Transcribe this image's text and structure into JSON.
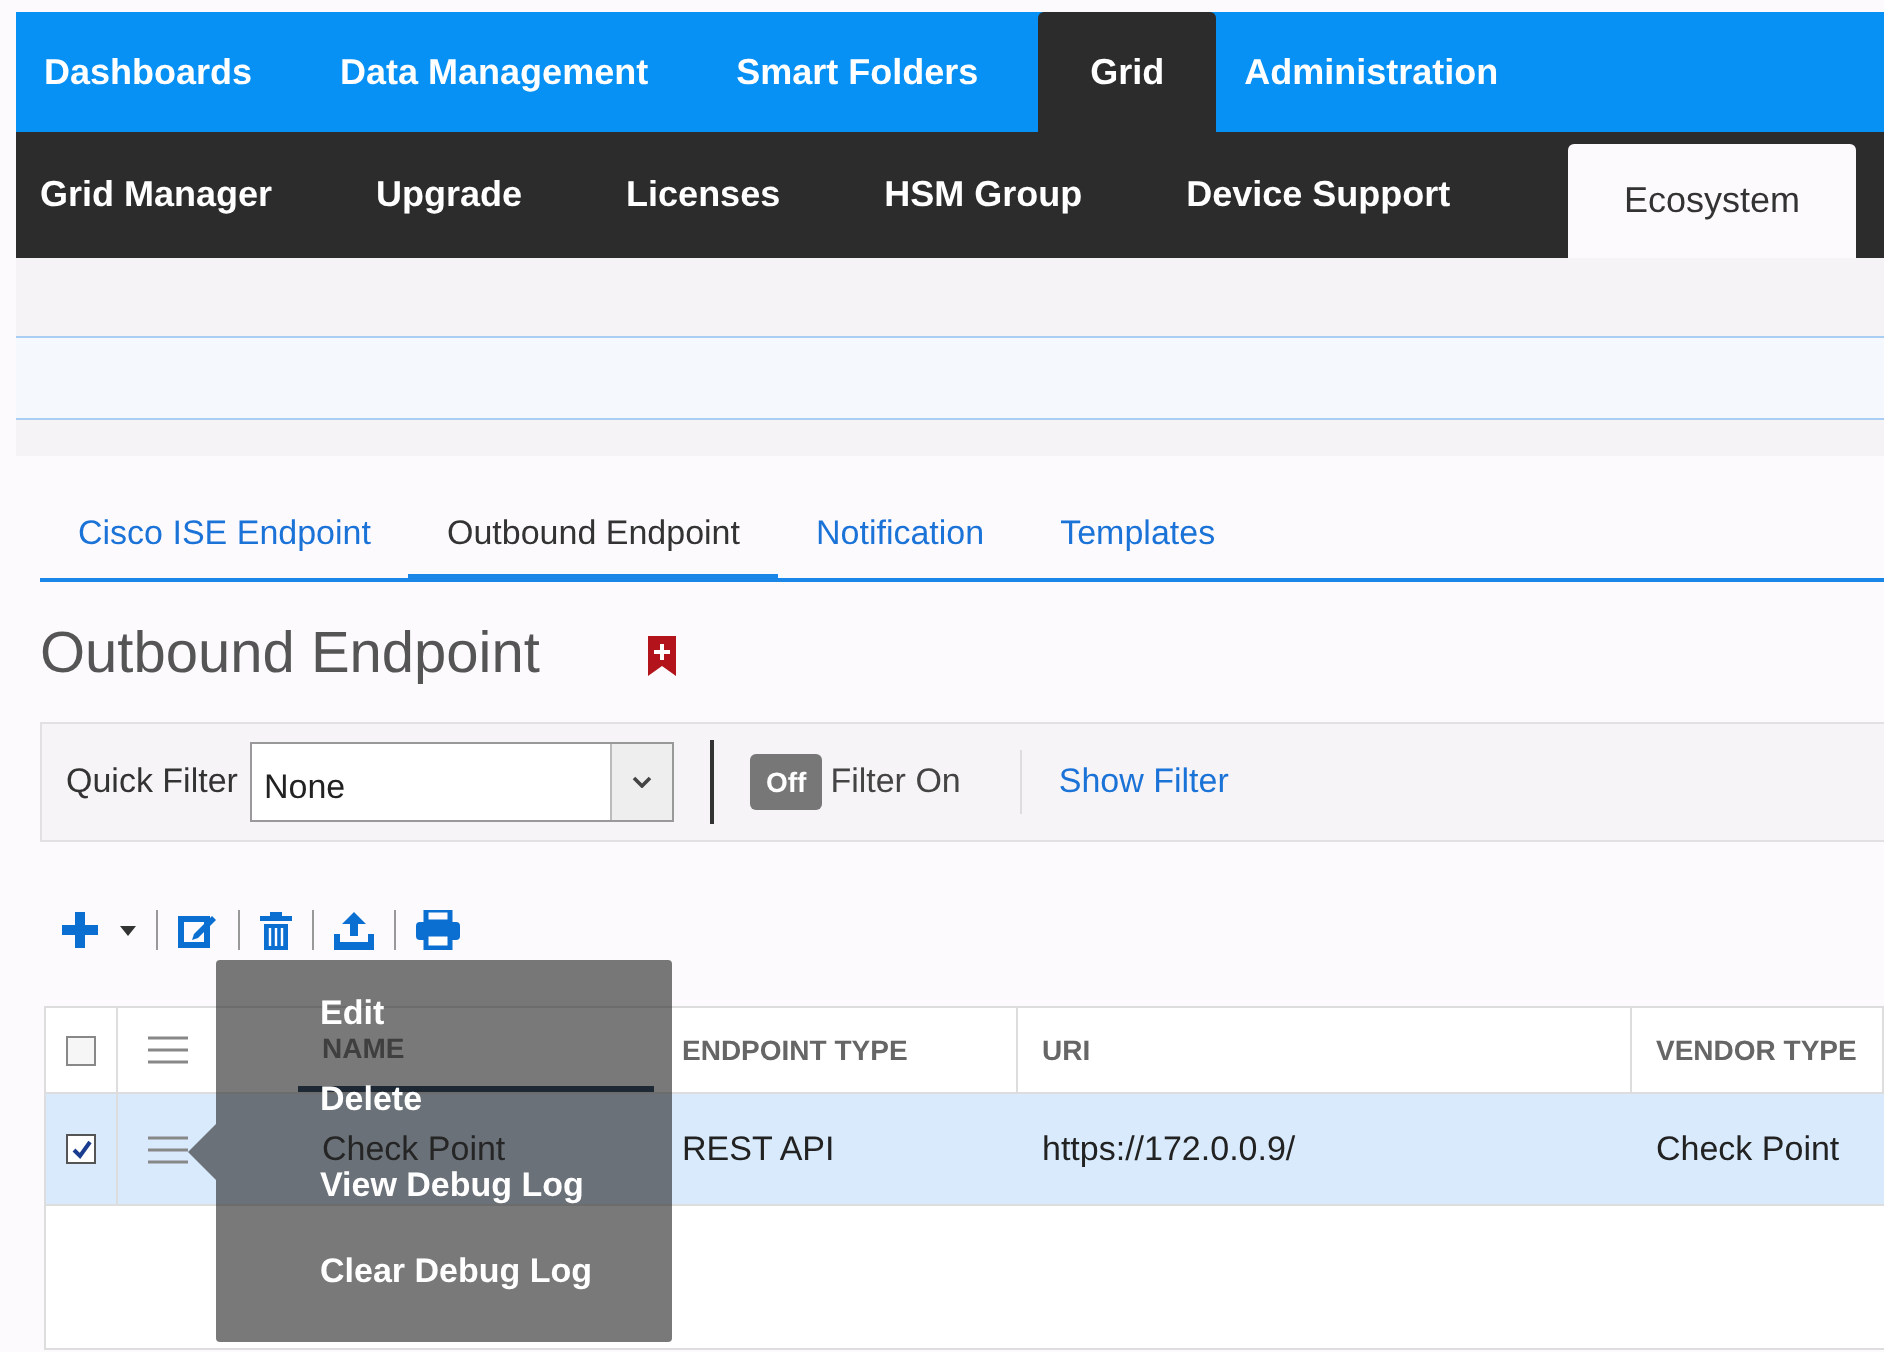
{
  "main_nav": [
    {
      "label": "Dashboards",
      "selected": false
    },
    {
      "label": "Data Management",
      "selected": false
    },
    {
      "label": "Smart Folders",
      "selected": false
    },
    {
      "label": "Grid",
      "selected": true
    },
    {
      "label": "Administration",
      "selected": false
    }
  ],
  "sub_nav": [
    {
      "label": "Grid Manager",
      "selected": false
    },
    {
      "label": "Upgrade",
      "selected": false
    },
    {
      "label": "Licenses",
      "selected": false
    },
    {
      "label": "HSM Group",
      "selected": false
    },
    {
      "label": "Device Support",
      "selected": false
    },
    {
      "label": "Ecosystem",
      "selected": true
    }
  ],
  "tabs": [
    {
      "label": "Cisco ISE Endpoint",
      "selected": false
    },
    {
      "label": "Outbound Endpoint",
      "selected": true
    },
    {
      "label": "Notification",
      "selected": false
    },
    {
      "label": "Templates",
      "selected": false
    }
  ],
  "heading": "Outbound Endpoint",
  "filter_bar": {
    "quick_filter_label": "Quick Filter",
    "quick_filter_value": "None",
    "toggle_text": "Off",
    "filter_on": false,
    "toggle_label": "Filter On",
    "show_filter": "Show Filter"
  },
  "table": {
    "select_all_checked": false,
    "columns": [
      "NAME",
      "ENDPOINT TYPE",
      "URI",
      "VENDOR TYPE"
    ],
    "rows": [
      {
        "checked": true,
        "selected": true,
        "cells": [
          "Check Point",
          "REST API",
          "https://172.0.0.9/",
          "Check Point"
        ]
      }
    ]
  },
  "context_menu": {
    "items": [
      "Edit",
      "Delete",
      "View Debug Log",
      "Clear Debug Log"
    ]
  }
}
